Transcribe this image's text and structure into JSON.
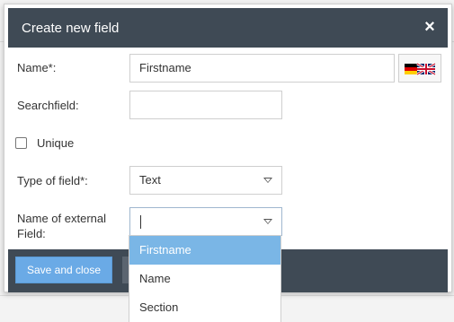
{
  "dialog": {
    "title": "Create new field",
    "close_label": "×"
  },
  "form": {
    "name": {
      "label": "Name*:",
      "value": "Firstname",
      "flag_icons": [
        "german-flag-icon",
        "uk-flag-icon"
      ]
    },
    "searchfield": {
      "label": "Searchfield:",
      "value": ""
    },
    "unique": {
      "label": "Unique",
      "checked": false
    },
    "type_of_field": {
      "label": "Type of field*:",
      "value": "Text"
    },
    "external_field": {
      "label_line1": "Name of external",
      "label_line2": "Field:",
      "value": ""
    }
  },
  "dropdown": {
    "options": [
      "Firstname",
      "Name",
      "Section"
    ],
    "highlighted_index": 0
  },
  "footer": {
    "save_label": "Save and close"
  },
  "colors": {
    "header_bg": "#3f4a55",
    "primary_button": "#6aaae6",
    "dropdown_highlight": "#7ab6e6"
  }
}
